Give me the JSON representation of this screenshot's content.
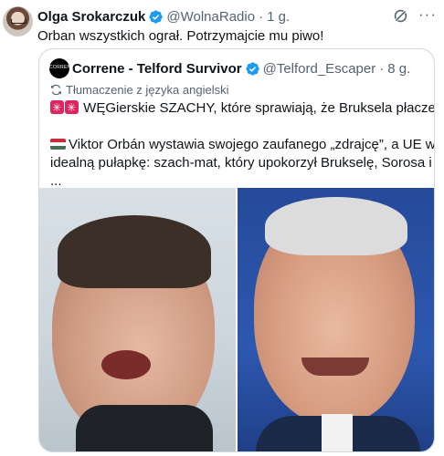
{
  "tweet": {
    "author_name": "Olga Srokarczuk",
    "handle": "@WolnaRadio",
    "separator": "·",
    "time": "1 g.",
    "text": "Orban wszystkich ograł. Potrzymajcie mu piwo!",
    "more_label": "···"
  },
  "quoted": {
    "avatar_text": "CORRENE",
    "author_name": "Correne - Telford Survivor",
    "handle": "@Telford_Escaper",
    "separator": "·",
    "time": "8 g.",
    "translation_label": "Tłumaczenie z języka angielski",
    "line1": "WĘGierskie SZACHY, które sprawiają, że Bruksela płacze",
    "line2": "Viktor Orbán wystawia swojego zaufanego „zdrajcę”, a UE wpada w",
    "line3": "idealną pułapkę: szach-mat, który upokorzył Brukselę, Sorosa i Obamę.",
    "line4": "..."
  },
  "icons": {
    "verified": "verified-badge-icon",
    "grok": "grok-icon",
    "translate": "translate-icon",
    "siren": "rotating-light-emoji",
    "laugh": "rolling-on-floor-laughing-emoji",
    "flag": "hungary-flag-emoji"
  },
  "colors": {
    "accent": "#1d9bf0",
    "muted": "#536471",
    "border": "#cfd9de"
  }
}
